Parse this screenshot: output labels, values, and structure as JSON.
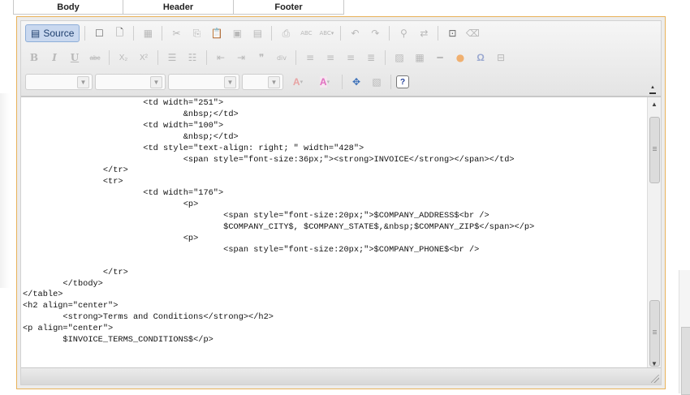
{
  "tabs": [
    "Body",
    "Header",
    "Footer"
  ],
  "toolbar": {
    "source_label": "Source",
    "row1_icons": [
      "new-page-icon",
      "preview-icon",
      "templates-icon",
      "cut-icon",
      "copy-icon",
      "paste-icon",
      "paste-text-icon",
      "paste-word-icon",
      "print-icon",
      "spellcheck-icon",
      "spellcheck-as-you-type-icon",
      "undo-icon",
      "redo-icon",
      "find-icon",
      "replace-icon",
      "select-all-icon",
      "remove-format-icon"
    ],
    "row2_icons": [
      "bold-icon",
      "italic-icon",
      "underline-icon",
      "strike-icon",
      "subscript-icon",
      "superscript-icon",
      "numbered-list-icon",
      "bulleted-list-icon",
      "outdent-icon",
      "indent-icon",
      "blockquote-icon",
      "div-icon",
      "align-left-icon",
      "align-center-icon",
      "align-right-icon",
      "justify-icon",
      "image-icon",
      "table-icon",
      "horizontal-rule-icon",
      "smiley-icon",
      "special-char-icon",
      "page-break-icon"
    ],
    "row3_combos": [
      "styles-combo",
      "format-combo",
      "font-combo",
      "size-combo"
    ],
    "row3_icons": [
      "text-color-icon",
      "background-color-icon",
      "maximize-icon",
      "show-blocks-icon",
      "about-icon"
    ],
    "glyphs": {
      "bold": "B",
      "italic": "I",
      "underline": "U",
      "strike": "abc",
      "subscript": "X₂",
      "superscript": "X²",
      "text_color": "A",
      "bg_color": "A",
      "about": "?",
      "omega": "Ω",
      "spell": "ABC",
      "spell2": "ABC"
    }
  },
  "source_code": [
    "                        <td width=\"251\">",
    "                                &nbsp;</td>",
    "                        <td width=\"100\">",
    "                                &nbsp;</td>",
    "                        <td style=\"text-align: right; \" width=\"428\">",
    "                                <span style=\"font-size:36px;\"><strong>INVOICE</strong></span></td>",
    "                </tr>",
    "                <tr>",
    "                        <td width=\"176\">",
    "                                <p>",
    "                                        <span style=\"font-size:20px;\">$COMPANY_ADDRESS$<br />",
    "                                        $COMPANY_CITY$, $COMPANY_STATE$,&nbsp;$COMPANY_ZIP$</span></p>",
    "                                <p>",
    "                                        <span style=\"font-size:20px;\">$COMPANY_PHONE$<br />",
    "",
    "                </tr>",
    "        </tbody>",
    "</table>",
    "<h2 align=\"center\">",
    "        <strong>Terms and Conditions</strong></h2>",
    "<p align=\"center\">",
    "        $INVOICE_TERMS_CONDITIONS$</p>"
  ],
  "colors": {
    "editor_border": "#e8b25a",
    "source_button_bg": "#c9d8ef",
    "source_button_border": "#8eaed8"
  }
}
